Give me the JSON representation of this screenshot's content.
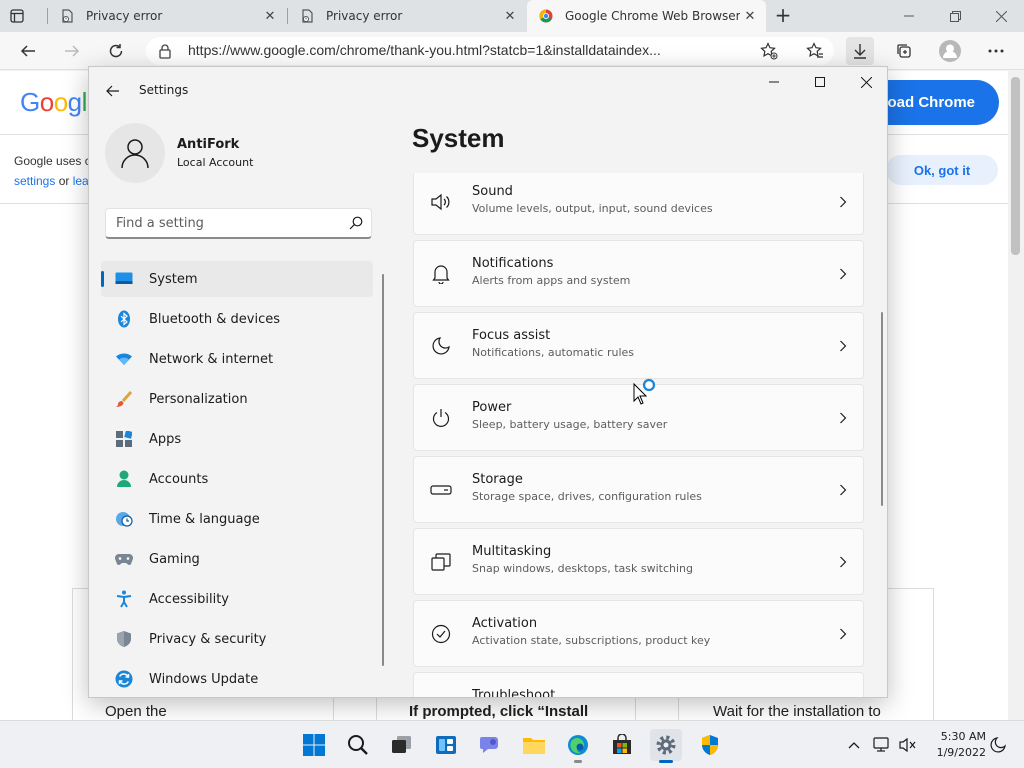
{
  "browser": {
    "tabs": [
      {
        "title": "Privacy error",
        "icon": "warning-doc-icon",
        "active": false
      },
      {
        "title": "Privacy error",
        "icon": "warning-doc-icon",
        "active": false
      },
      {
        "title": "Google Chrome Web Browser",
        "icon": "chrome-icon",
        "active": true
      }
    ],
    "url": "https://www.google.com/chrome/thank-you.html?statcb=1&installdataindex..."
  },
  "page": {
    "logo": "Google",
    "download_label": "oad Chrome",
    "cookie_line1": "Google uses c",
    "cookie_link1": "settings",
    "cookie_or": " or ",
    "cookie_link2": "lea",
    "ok_label": "Ok, got it",
    "steps": [
      "Open the",
      "If prompted, click “Install",
      "Wait for the installation to"
    ]
  },
  "settings": {
    "window_title": "Settings",
    "account": {
      "name": "AntiFork",
      "type": "Local Account"
    },
    "search_placeholder": "Find a setting",
    "nav": [
      {
        "label": "System",
        "icon": "system-icon",
        "selected": true
      },
      {
        "label": "Bluetooth & devices",
        "icon": "bluetooth-icon"
      },
      {
        "label": "Network & internet",
        "icon": "wifi-icon"
      },
      {
        "label": "Personalization",
        "icon": "brush-icon"
      },
      {
        "label": "Apps",
        "icon": "apps-icon"
      },
      {
        "label": "Accounts",
        "icon": "accounts-icon"
      },
      {
        "label": "Time & language",
        "icon": "globe-clock-icon"
      },
      {
        "label": "Gaming",
        "icon": "gamepad-icon"
      },
      {
        "label": "Accessibility",
        "icon": "accessibility-icon"
      },
      {
        "label": "Privacy & security",
        "icon": "shield-icon"
      },
      {
        "label": "Windows Update",
        "icon": "update-icon"
      }
    ],
    "page_title": "System",
    "items": [
      {
        "title": "Sound",
        "subtitle": "Volume levels, output, input, sound devices",
        "icon": "speaker-icon"
      },
      {
        "title": "Notifications",
        "subtitle": "Alerts from apps and system",
        "icon": "bell-icon"
      },
      {
        "title": "Focus assist",
        "subtitle": "Notifications, automatic rules",
        "icon": "moon-icon"
      },
      {
        "title": "Power",
        "subtitle": "Sleep, battery usage, battery saver",
        "icon": "power-icon"
      },
      {
        "title": "Storage",
        "subtitle": "Storage space, drives, configuration rules",
        "icon": "storage-icon"
      },
      {
        "title": "Multitasking",
        "subtitle": "Snap windows, desktops, task switching",
        "icon": "multitasking-icon"
      },
      {
        "title": "Activation",
        "subtitle": "Activation state, subscriptions, product key",
        "icon": "check-circle-icon"
      },
      {
        "title": "Troubleshoot",
        "subtitle": "",
        "icon": "wrench-icon"
      }
    ]
  },
  "taskbar": {
    "time": "5:30 AM",
    "date": "1/9/2022"
  },
  "colors": {
    "accent": "#0067c0",
    "google_blue": "#1a73e8",
    "settings_bg": "#f3f3f3"
  }
}
